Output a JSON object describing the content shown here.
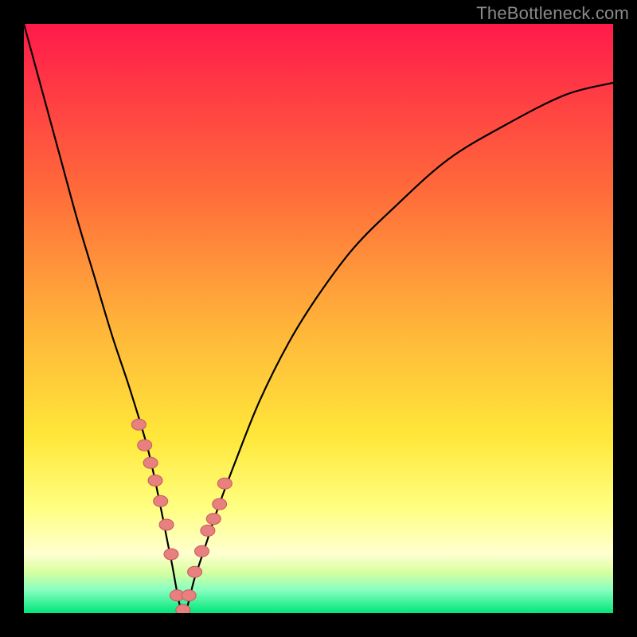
{
  "watermark": {
    "text": "TheBottleneck.com"
  },
  "colors": {
    "red": "#ff1a4b",
    "orange": "#ff9a2a",
    "yellow": "#ffe73a",
    "paleyellow": "#ffff9a",
    "lightgreen": "#b7ff7a",
    "green": "#00e67a",
    "curve": "#000000",
    "marker_fill": "#e88080",
    "marker_stroke": "#c55a5a",
    "frame": "#000000"
  },
  "chart_data": {
    "type": "line",
    "title": "",
    "xlabel": "",
    "ylabel": "",
    "xlim": [
      0,
      100
    ],
    "ylim": [
      0,
      100
    ],
    "grid": false,
    "legend": false,
    "notch_x": 27,
    "series": [
      {
        "name": "bottleneck-curve",
        "x": [
          0,
          3,
          6,
          9,
          12,
          15,
          18,
          21,
          23,
          25,
          27,
          29,
          31,
          33,
          36,
          40,
          45,
          50,
          56,
          63,
          72,
          82,
          92,
          100
        ],
        "y": [
          100,
          89,
          78,
          67,
          57,
          47,
          38,
          28,
          19,
          9,
          0,
          6,
          12,
          18,
          26,
          36,
          46,
          54,
          62,
          69,
          77,
          83,
          88,
          90
        ]
      }
    ],
    "markers": {
      "name": "highlighted-points",
      "x": [
        19.5,
        20.5,
        21.5,
        22.3,
        23.2,
        24.2,
        25.0,
        26.0,
        27.0,
        28.0,
        29.0,
        30.2,
        31.2,
        32.2,
        33.2,
        34.1
      ],
      "y": [
        32.0,
        28.5,
        25.5,
        22.5,
        19.0,
        15.0,
        10.0,
        3.0,
        0.5,
        3.0,
        7.0,
        10.5,
        14.0,
        16.0,
        18.5,
        22.0
      ]
    },
    "background_gradient_stops": [
      {
        "pos": 0.0,
        "color": "#ff1a4b"
      },
      {
        "pos": 0.28,
        "color": "#ff6a3a"
      },
      {
        "pos": 0.52,
        "color": "#ffb63a"
      },
      {
        "pos": 0.7,
        "color": "#ffe73a"
      },
      {
        "pos": 0.82,
        "color": "#ffff80"
      },
      {
        "pos": 0.9,
        "color": "#ffffd0"
      },
      {
        "pos": 0.93,
        "color": "#d8ffa0"
      },
      {
        "pos": 0.96,
        "color": "#8affc0"
      },
      {
        "pos": 1.0,
        "color": "#00e67a"
      }
    ]
  }
}
